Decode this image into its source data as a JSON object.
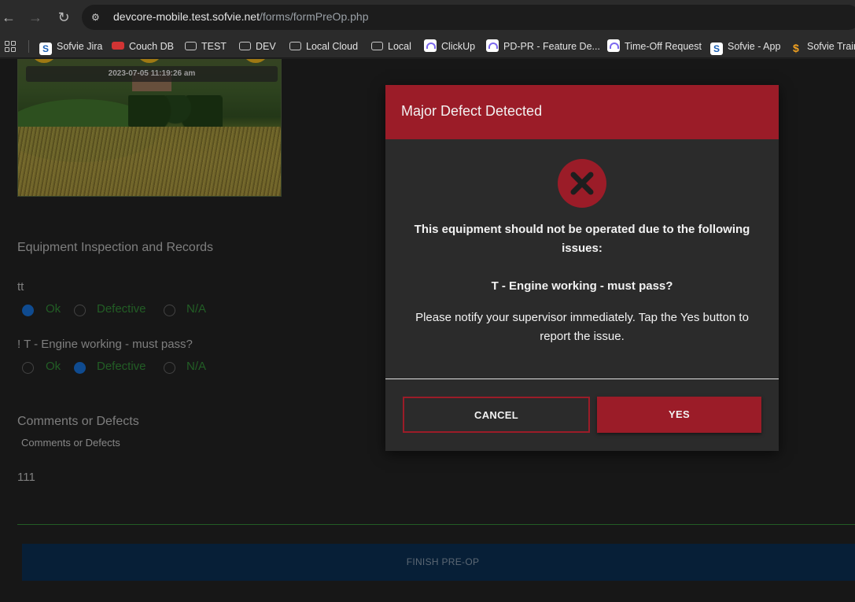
{
  "browser": {
    "url_host": "devcore-mobile.test.sofvie.net",
    "url_path": "/forms/formPreOp.php",
    "bookmarks": [
      {
        "label": "Sofvie Jira",
        "icon": "sofvie-icon"
      },
      {
        "label": "Couch DB",
        "icon": "couch-icon"
      },
      {
        "label": "TEST",
        "icon": "folder-icon"
      },
      {
        "label": "DEV",
        "icon": "folder-icon"
      },
      {
        "label": "Local Cloud",
        "icon": "folder-icon"
      },
      {
        "label": "Local",
        "icon": "folder-icon"
      },
      {
        "label": "ClickUp",
        "icon": "clickup-icon"
      },
      {
        "label": "PD-PR - Feature De...",
        "icon": "clickup-icon"
      },
      {
        "label": "Time-Off Request",
        "icon": "clickup-icon"
      },
      {
        "label": "Sofvie - App",
        "icon": "sofvie-icon"
      },
      {
        "label": "Sofvie Trair",
        "icon": "sofvie-icon"
      }
    ]
  },
  "form": {
    "photo_timestamp": "2023-07-05 11:19:26 am",
    "section_title": "Equipment Inspection and Records",
    "questions": [
      {
        "label": "tt",
        "options": [
          "Ok",
          "Defective",
          "N/A"
        ],
        "selected": "Ok"
      },
      {
        "label": "! T - Engine working - must pass?",
        "options": [
          "Ok",
          "Defective",
          "N/A"
        ],
        "selected": "Defective"
      }
    ],
    "comments_title": "Comments or Defects",
    "comments_label": "Comments or Defects",
    "comments_value": "111",
    "finish_label": "FINISH PRE-OP"
  },
  "modal": {
    "title": "Major Defect Detected",
    "warning": "This equipment should not be operated due to the following issues:",
    "issue": "T - Engine working - must pass?",
    "notify": "Please notify your supervisor immediately. Tap the Yes button to report the issue.",
    "cancel_label": "CANCEL",
    "yes_label": "YES"
  },
  "colors": {
    "accent_red": "#9b1c28",
    "radio_checked": "#1565c0",
    "option_text": "#2e7d32"
  }
}
